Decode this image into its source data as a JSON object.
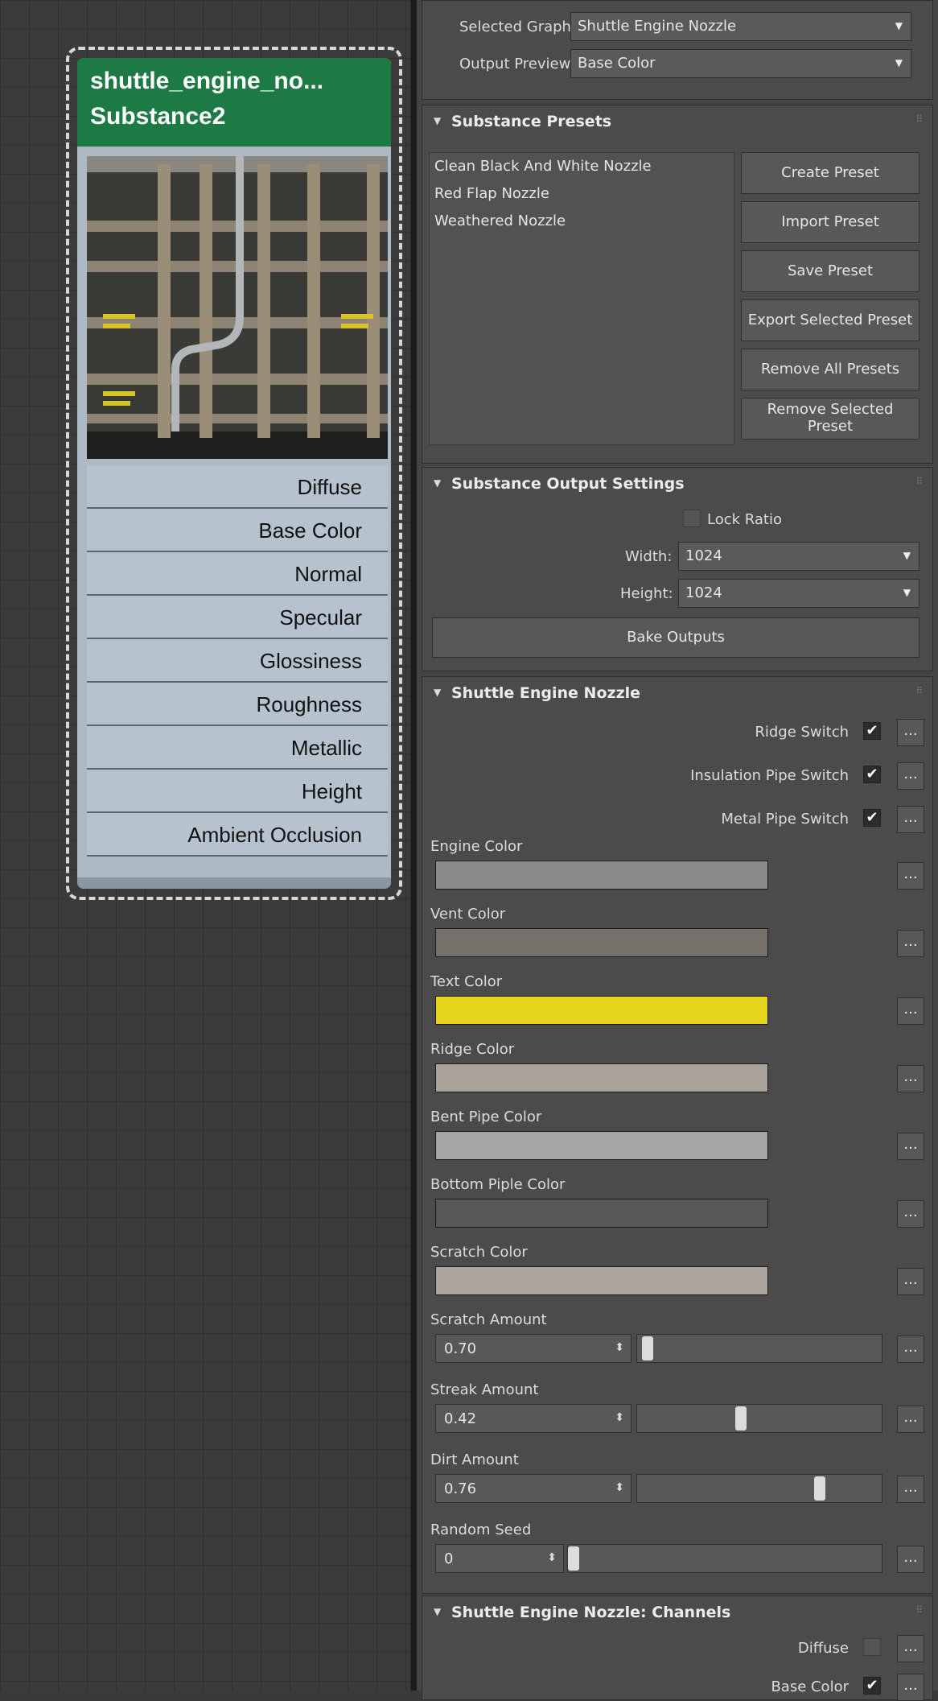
{
  "node": {
    "title": "shuttle_engine_no...",
    "subtitle": "Substance2",
    "header_color": "#1d7a45",
    "outputs": [
      "Diffuse",
      "Base Color",
      "Normal",
      "Specular",
      "Glossiness",
      "Roughness",
      "Metallic",
      "Height",
      "Ambient Occlusion"
    ]
  },
  "graph": {
    "selected_graph_label": "Selected Graph:",
    "selected_graph_value": "Shuttle Engine Nozzle",
    "output_preview_label": "Output Preview:",
    "output_preview_value": "Base Color"
  },
  "presets": {
    "title": "Substance Presets",
    "items": [
      "Clean Black And White Nozzle",
      "Red Flap Nozzle",
      "Weathered Nozzle"
    ],
    "buttons": [
      "Create Preset",
      "Import Preset",
      "Save Preset",
      "Export Selected Preset",
      "Remove All Presets",
      "Remove Selected Preset"
    ]
  },
  "output_settings": {
    "title": "Substance Output Settings",
    "lock_ratio_label": "Lock Ratio",
    "lock_ratio_checked": false,
    "width_label": "Width:",
    "width_value": "1024",
    "height_label": "Height:",
    "height_value": "1024",
    "bake_label": "Bake Outputs"
  },
  "params": {
    "title": "Shuttle Engine Nozzle",
    "switches": [
      {
        "label": "Ridge Switch",
        "checked": true
      },
      {
        "label": "Insulation Pipe Switch",
        "checked": true
      },
      {
        "label": "Metal Pipe Switch",
        "checked": true
      }
    ],
    "colors": [
      {
        "label": "Engine Color",
        "color": "#8a8a8a"
      },
      {
        "label": "Vent Color",
        "color": "#76706a"
      },
      {
        "label": "Text Color",
        "color": "#e5d41d"
      },
      {
        "label": "Ridge Color",
        "color": "#a9a39c"
      },
      {
        "label": "Bent Pipe Color",
        "color": "#a5a5a5"
      },
      {
        "label": "Bottom Piple Color",
        "color": "#575757"
      },
      {
        "label": "Scratch Color",
        "color": "#aca59e"
      }
    ],
    "sliders": [
      {
        "label": "Scratch Amount",
        "value": "0.70",
        "level": 0.02
      },
      {
        "label": "Streak Amount",
        "value": "0.42",
        "level": 0.42
      },
      {
        "label": "Dirt Amount",
        "value": "0.76",
        "level": 0.76
      }
    ],
    "seed": {
      "label": "Random Seed",
      "value": "0",
      "level": 0.0
    },
    "more_label": "..."
  },
  "channels": {
    "title": "Shuttle Engine Nozzle: Channels",
    "items": [
      {
        "label": "Diffuse",
        "checked": false
      },
      {
        "label": "Base Color",
        "checked": true
      }
    ]
  }
}
